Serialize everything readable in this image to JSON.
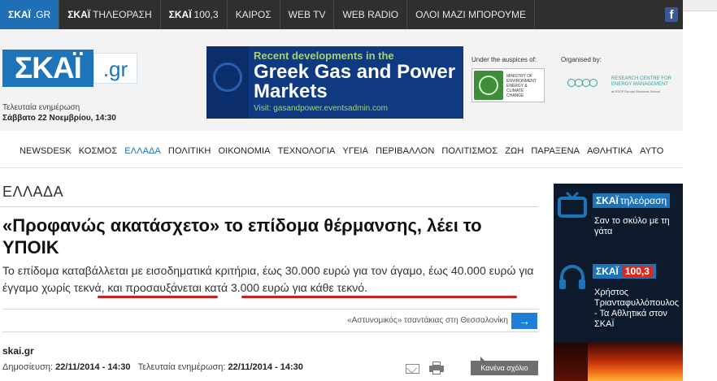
{
  "topnav": {
    "items": [
      {
        "bold": "ΣΚΑΪ",
        "rest": ".GR"
      },
      {
        "bold": "ΣΚΑΪ",
        "rest": "ΤΗΛΕΟΡΑΣΗ"
      },
      {
        "bold": "ΣΚΑΪ",
        "rest": "100,3"
      },
      {
        "bold": "",
        "rest": "ΚΑΙΡΟΣ"
      },
      {
        "bold": "",
        "rest": "WEB TV"
      },
      {
        "bold": "",
        "rest": "WEB RADIO"
      },
      {
        "bold": "",
        "rest": "ΟΛΟΙ ΜΑΖΙ ΜΠΟΡΟΥΜΕ"
      }
    ],
    "facebook": "f"
  },
  "logo": {
    "main": "ΣΚΑΪ",
    "suffix": ".gr"
  },
  "update": {
    "label": "Τελευταία ενημέρωση",
    "date": "Σάββατο 22 Νοεμβρίου, 14:30"
  },
  "banner": {
    "line1": "Recent developments in the",
    "line2": "Greek Gas and Power Markets",
    "line3": "Visit: gasandpower.eventsadmin.com"
  },
  "sponsors": {
    "auspices_label": "Under the auspices of:",
    "auspices_text": "MINISTRY OF ENVIRONMENT ENERGY & CLIMATE CHANGE",
    "organised_label": "Organised by:",
    "organised_text": "RESEARCH CENTRE FOR ENERGY MANAGEMENT",
    "organised_sub": "at ESCP Europe Business School"
  },
  "mainnav": {
    "items": [
      "NEWSDESK",
      "ΚΟΣΜΟΣ",
      "ΕΛΛΑΔΑ",
      "ΠΟΛΙΤΙΚΗ",
      "ΟΙΚΟΝΟΜΙΑ",
      "ΤΕΧΝΟΛΟΓΙΑ",
      "ΥΓΕΙΑ",
      "ΠΕΡΙΒΑΛΛΟΝ",
      "ΠΟΛΙΤΙΣΜΟΣ",
      "ΖΩΗ",
      "ΠΑΡΑΞΕΝΑ",
      "ΑΘΛΗΤΙΚΑ",
      "ΑΥΤΟ"
    ],
    "active": "ΕΛΛΑΔΑ"
  },
  "article": {
    "section": "ΕΛΛΑΔΑ",
    "title": "«Προφανώς ακατάσχετο» το επίδομα θέρμανσης, λέει το ΥΠΟΙΚ",
    "lead_part1": "Το επίδομα καταβάλλεται με εισοδηματικά κριτήρια, έως 30.000 ευρώ για τον άγαμο, έως 40.000 ευρώ για ",
    "lead_hl1": "έγγαμο χωρίς τεκνά",
    "lead_part2": ", και ",
    "lead_hl2": "προσαυξάνεται κατά 3.000 ευρώ για κάθε τεκνό",
    "lead_part3": ".",
    "related": "«Αστυνομικός» τσαντάκιας στη Θεσσαλονίκη",
    "related_arrow": "→",
    "source": "skai.gr",
    "published_label": "Δημοσίευση:",
    "published": "22/11/2014 - 14:30",
    "updated_label": "Τελευταία ενημέρωση:",
    "updated": "22/11/2014 - 14:30",
    "comments": "Κανένα σχόλιο"
  },
  "sidebar": {
    "tv_badge_bold": "ΣΚΑΪ",
    "tv_badge": "τηλεόραση",
    "tv_text": "Σαν το σκύλο με τη γάτα",
    "radio_badge_bold": "ΣΚΑΪ",
    "radio_badge": "100,3",
    "radio_text": "Χρήστος Τριανταφυλλόπουλος - Τα Αθλητικά στον ΣΚΑΪ"
  },
  "colors": {
    "brand_blue": "#1d74b8",
    "topbar": "#2f2f2f",
    "underline_red": "#cc1f1f",
    "sidebar_bg": "#0c1a2b"
  }
}
